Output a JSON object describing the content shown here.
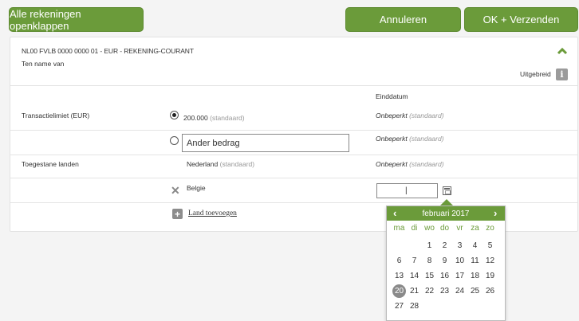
{
  "toolbar": {
    "expand_all": "Alle rekeningen openklappen",
    "cancel": "Annuleren",
    "ok_send": "OK + Verzenden"
  },
  "account": {
    "line1": "NL00 FVLB 0000 0000 01 - EUR - REKENING-COURANT",
    "line2": "Ten name van",
    "extended_label": "Uitgebreid",
    "info_glyph": "i"
  },
  "table": {
    "end_date_header": "Einddatum",
    "rows": [
      {
        "label": "Transactielimiet (EUR)",
        "value": "200.000",
        "value_note": "(standaard)",
        "end_main": "Onbeperkt",
        "end_note": "(standaard)"
      },
      {
        "label": "",
        "input_value": "Ander bedrag",
        "end_main": "Onbeperkt",
        "end_note": "(standaard)"
      },
      {
        "label": "Toegestane landen",
        "value": "Nederland",
        "value_note": "(standaard)",
        "end_main": "Onbeperkt",
        "end_note": "(standaard)"
      },
      {
        "label": "",
        "value": "Belgie",
        "end_input_value": "|"
      }
    ],
    "add_country": "Land toevoegen",
    "remove_glyph": "✕",
    "add_glyph": "+"
  },
  "calendar": {
    "month_label": "februari 2017",
    "prev": "‹",
    "next": "›",
    "weekdays": [
      "ma",
      "di",
      "wo",
      "do",
      "vr",
      "za",
      "zo"
    ],
    "weeks": [
      [
        "",
        "",
        "1",
        "2",
        "3",
        "4",
        "5"
      ],
      [
        "6",
        "7",
        "8",
        "9",
        "10",
        "11",
        "12"
      ],
      [
        "13",
        "14",
        "15",
        "16",
        "17",
        "18",
        "19"
      ],
      [
        "20",
        "21",
        "22",
        "23",
        "24",
        "25",
        "26"
      ],
      [
        "27",
        "28",
        "",
        "",
        "",
        "",
        ""
      ]
    ],
    "selected": "20"
  },
  "colors": {
    "accent_green": "#6b9b3a",
    "selected_grey": "#8a8a8a"
  }
}
